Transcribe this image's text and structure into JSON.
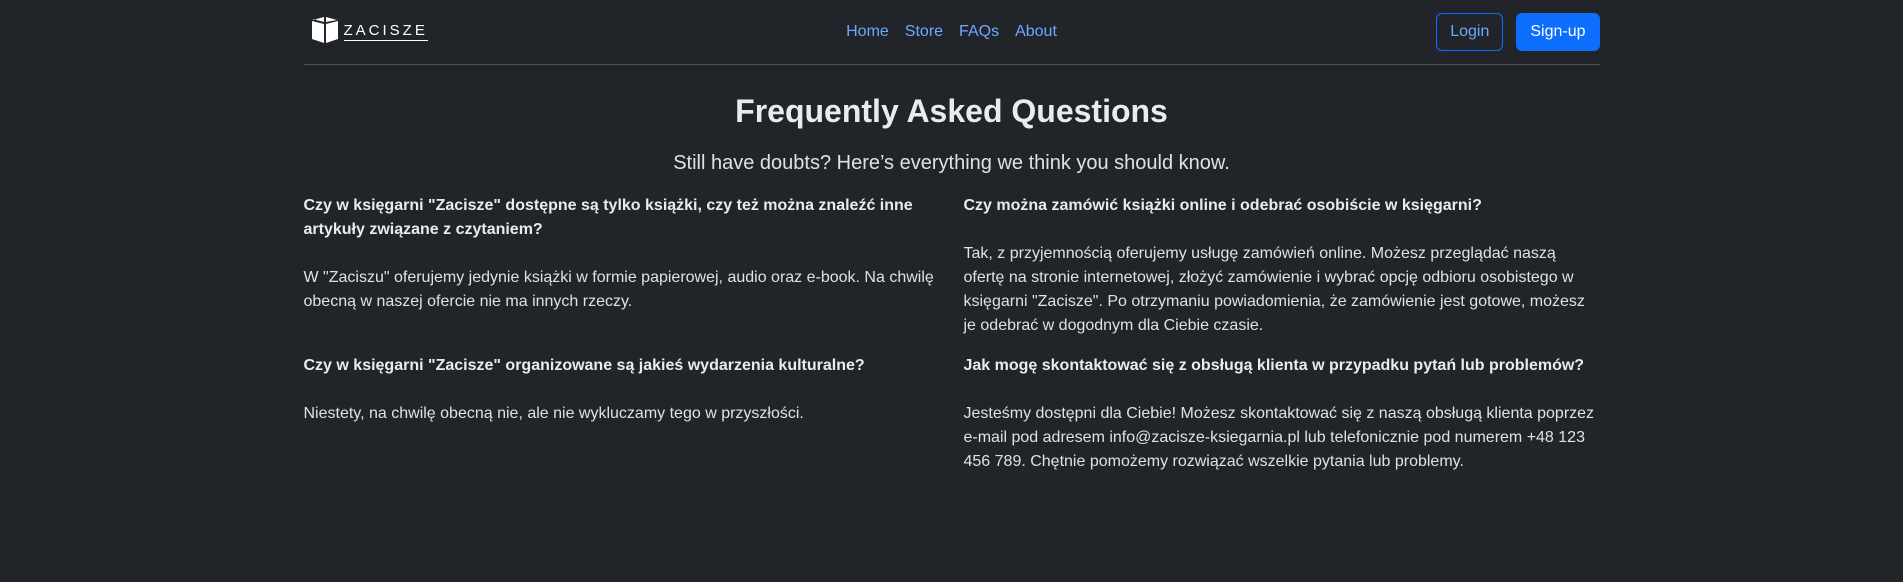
{
  "brand": {
    "name": "ZACISZE",
    "logo_icon": "open-book-icon"
  },
  "nav": {
    "links": [
      "Home",
      "Store",
      "FAQs",
      "About"
    ],
    "link_color": "#6ea8fe"
  },
  "actions": {
    "login_label": "Login",
    "signup_label": "Sign-up",
    "accent_color": "#0d6efd"
  },
  "page": {
    "title": "Frequently Asked Questions",
    "lead": "Still have doubts? Here’s everything we think you should know."
  },
  "faq": [
    {
      "question": "Czy w księgarni \"Zacisze\" dostępne są tylko książki, czy też można znaleźć inne artykuły związane z czytaniem?",
      "answer": "W \"Zaciszu\" oferujemy jedynie książki w formie papierowej, audio oraz e-book. Na chwilę obecną w naszej ofercie nie ma innych rzeczy."
    },
    {
      "question": "Czy można zamówić książki online i odebrać osobiście w księgarni?",
      "answer": "Tak, z przyjemnością oferujemy usługę zamówień online. Możesz przeglądać naszą ofertę na stronie internetowej, złożyć zamówienie i wybrać opcję odbioru osobistego w księgarni \"Zacisze\". Po otrzymaniu powiadomienia, że zamówienie jest gotowe, możesz je odebrać w dogodnym dla Ciebie czasie."
    },
    {
      "question": "Czy w księgarni \"Zacisze\" organizowane są jakieś wydarzenia kulturalne?",
      "answer": "Niestety, na chwilę obecną nie, ale nie wykluczamy tego w przyszłości."
    },
    {
      "question": "Jak mogę skontaktować się z obsługą klienta w przypadku pytań lub problemów?",
      "answer": "Jesteśmy dostępni dla Ciebie! Możesz skontaktować się z naszą obsługą klienta poprzez e-mail pod adresem info@zacisze-ksiegarnia.pl lub telefonicznie pod numerem +48 123 456 789. Chętnie pomożemy rozwiązać wszelkie pytania lub problemy."
    }
  ],
  "theme": {
    "background": "#212529",
    "text": "#dee2e6"
  }
}
